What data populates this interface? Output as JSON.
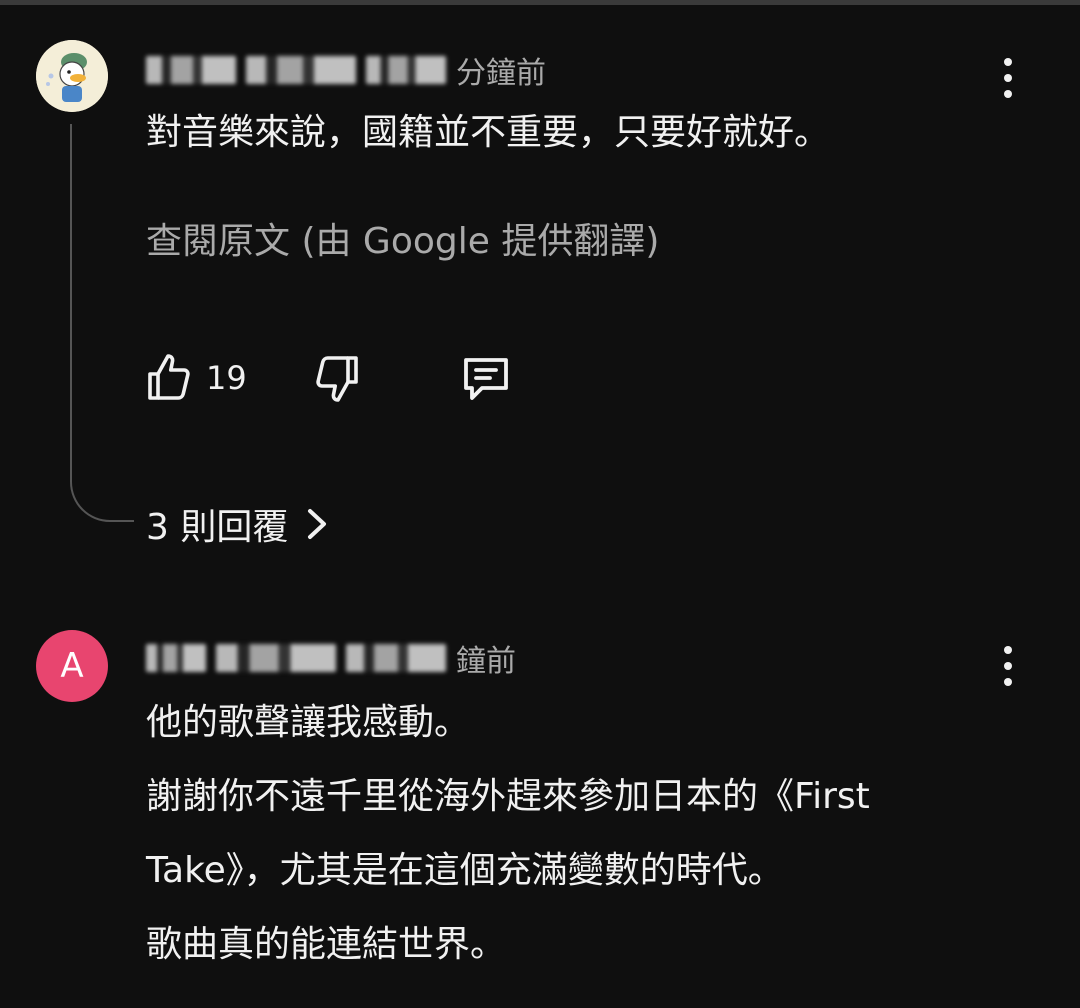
{
  "comments": [
    {
      "author_initial": "",
      "time_ago": "分鐘前",
      "text": "對音樂來說，國籍並不重要，只要好就好。",
      "translate_label": "查閱原文 (由 Google 提供翻譯)",
      "like_count": "19",
      "replies_label": "3 則回覆"
    },
    {
      "author_initial": "A",
      "avatar_color": "#e8456f",
      "time_ago": "鐘前",
      "lines": [
        "他的歌聲讓我感動。",
        "謝謝你不遠千里從海外趕來參加日本的《First",
        "Take》，尤其是在這個充滿變數的時代。",
        "歌曲真的能連結世界。"
      ]
    }
  ],
  "icons": {
    "like": "thumbs-up-icon",
    "dislike": "thumbs-down-icon",
    "reply": "comment-icon",
    "more": "more-vert-icon",
    "chevron": "chevron-right-icon"
  }
}
